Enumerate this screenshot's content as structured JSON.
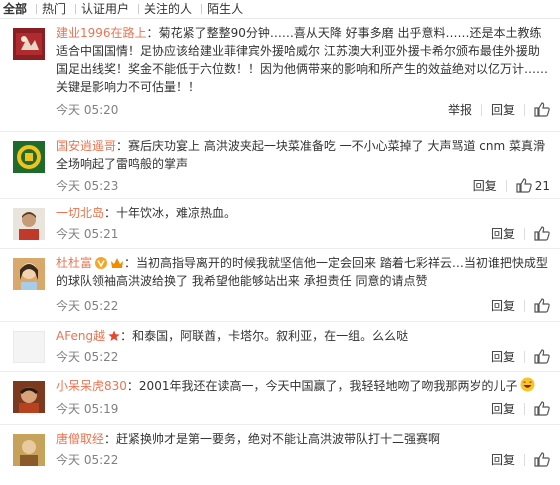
{
  "tabs": [
    "全部",
    "热门",
    "认证用户",
    "关注的人",
    "陌生人"
  ],
  "actions": {
    "report": "举报",
    "reply": "回复"
  },
  "comments": [
    {
      "name": "建业1996在路上",
      "text": "菊花紧了整整90分钟……喜从天降 好事多磨 出乎意料……还是本土教练适合中国国情！足协应该给建业菲律宾外援哈威尔 江苏澳大利亚外援卡希尔颁布最佳外援助国足出线奖！奖金不能低于六位数！！因为他俩带来的影响和所产生的效益绝对以亿万计……关键是影响力不可估量！！",
      "time": "今天 05:20",
      "likes": ""
    },
    {
      "name": "国安逍遥哥",
      "text": "赛后庆功宴上 高洪波夹起一块菜准备吃 一不小心菜掉了 大声骂道 cnm 菜真滑 全场响起了雷鸣般的掌声",
      "time": "今天 05:23",
      "likes": "21"
    },
    {
      "name": "一切北岛",
      "text": "十年饮冰，难凉热血。",
      "time": "今天 05:21",
      "likes": ""
    },
    {
      "name": "杜杜富",
      "text": "当初高指导离开的时候我就坚信他一定会回来 踏着七彩祥云…当初谁把快成型的球队领袖高洪波给换了 我希望他能够站出来 承担责任 同意的请点赞",
      "time": "今天 05:22",
      "likes": ""
    },
    {
      "name": "AFeng越",
      "text": "和泰国，阿联酋，卡塔尔。叙利亚，在一组。么么哒",
      "time": "今天 05:22",
      "likes": ""
    },
    {
      "name": "小呆呆虎830",
      "text": "2001年我还在读高一，今天中国赢了，我轻轻地吻了吻我那两岁的儿子",
      "time": "今天 05:19",
      "likes": ""
    },
    {
      "name": "唐僧取经",
      "text": "赶紧换帅才是第一要务，绝对不能让高洪波带队打十二强赛啊",
      "time": "今天 05:22",
      "likes": ""
    }
  ],
  "colors": {
    "name": "#eb7350",
    "time": "#808080",
    "divider": "#ececec"
  },
  "icons": {
    "like": "thumb-up-icon",
    "gold_badge": "gold-v-icon",
    "star_badge": "star-icon",
    "crown_badge": "crown-icon",
    "emoji": "laughing-emoji-icon"
  }
}
